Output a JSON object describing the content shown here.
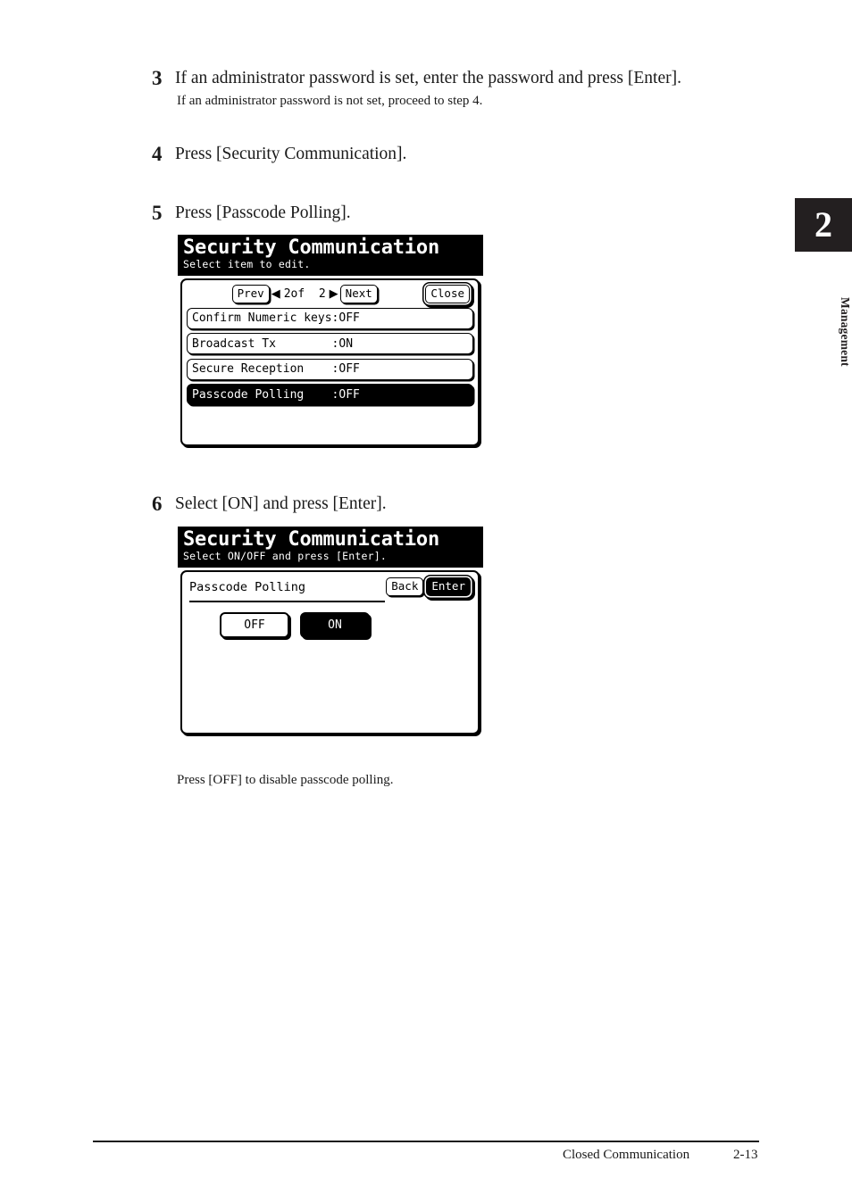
{
  "chapter": {
    "number": "2",
    "label": "Management"
  },
  "steps": [
    {
      "num": "3",
      "text": "If an administrator password is set, enter the password and press [Enter].",
      "sub": "If an administrator password is not set, proceed to step 4."
    },
    {
      "num": "4",
      "text": "Press [Security Communication]."
    },
    {
      "num": "5",
      "text": "Press [Passcode Polling]."
    },
    {
      "num": "6",
      "text": "Select [ON] and press [Enter]."
    }
  ],
  "note_off": "Press [OFF] to disable passcode polling.",
  "lcd1": {
    "title": "Security Communication",
    "subtitle": "Select item to edit.",
    "pager": {
      "prev_label": "Prev",
      "left_arrow": "◀",
      "page_text": "2of  2",
      "right_arrow": "▶",
      "next_label": "Next",
      "close_label": "Close"
    },
    "rows": [
      {
        "label": "Confirm Numeric keys",
        "value": ":OFF",
        "selected": false,
        "pad": ""
      },
      {
        "label": "Broadcast Tx",
        "value": ":ON",
        "selected": false,
        "pad": "        "
      },
      {
        "label": "Secure Reception",
        "value": ":OFF",
        "selected": false,
        "pad": "    "
      },
      {
        "label": "Passcode Polling",
        "value": ":OFF",
        "selected": true,
        "pad": "    "
      }
    ]
  },
  "lcd2": {
    "title": "Security Communication",
    "subtitle": "Select ON/OFF and press [Enter].",
    "field_name": "Passcode Polling",
    "back_label": "Back",
    "enter_label": "Enter",
    "choices": [
      {
        "label": "OFF",
        "selected": false
      },
      {
        "label": "ON",
        "selected": true
      }
    ]
  },
  "footer": {
    "section": "Closed Communication",
    "page": "2-13"
  }
}
